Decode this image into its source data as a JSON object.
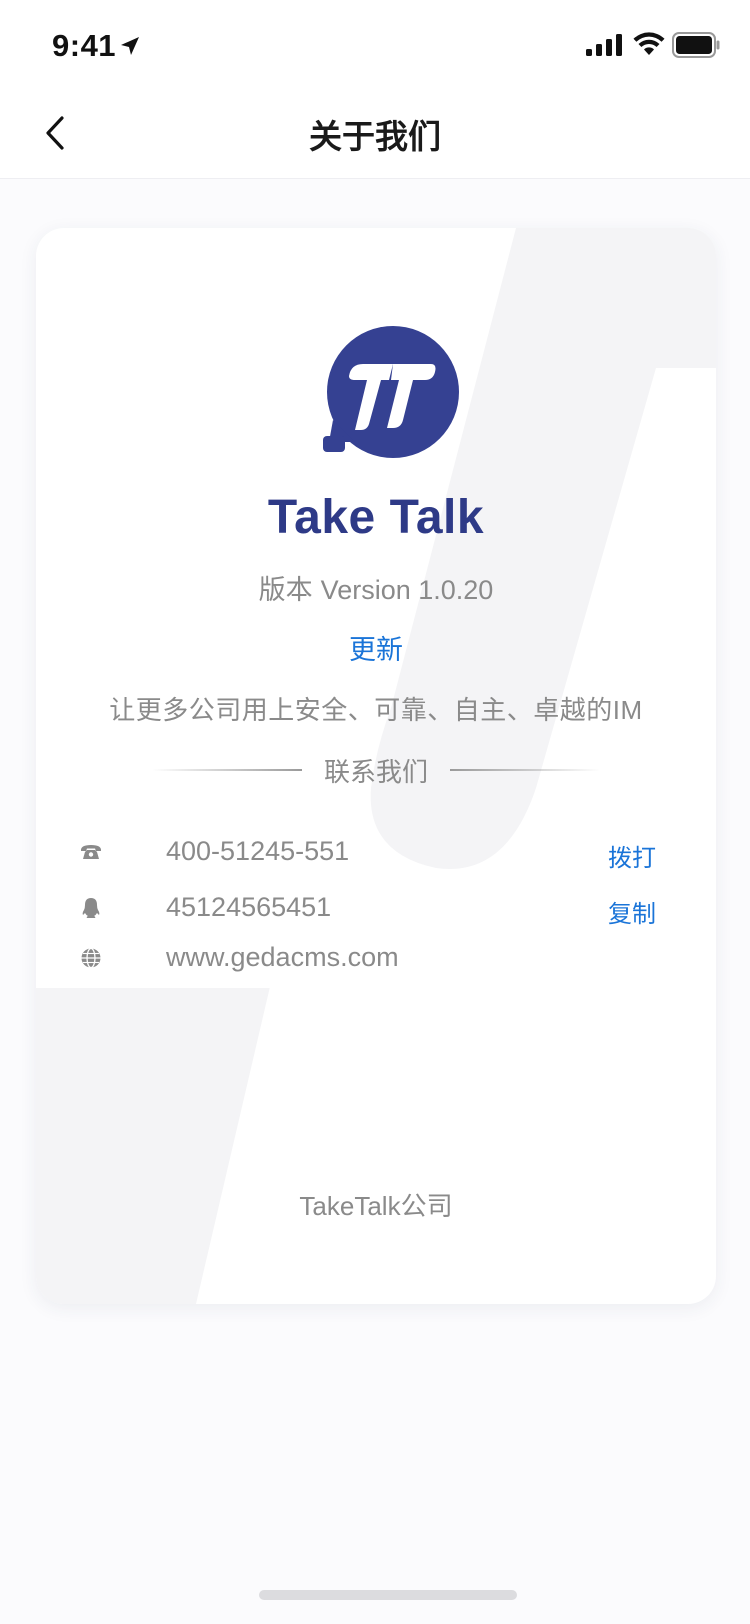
{
  "status_bar": {
    "time": "9:41",
    "icons": [
      "location-arrow-icon",
      "signal-icon",
      "wifi-icon",
      "battery-icon"
    ]
  },
  "nav": {
    "title": "关于我们",
    "back_icon": "chevron-left-icon"
  },
  "about": {
    "app_name": "Take Talk",
    "version_prefix": "版本",
    "version": "Version 1.0.20",
    "update_label": "更新",
    "slogan": "让更多公司用上安全、可靠、自主、卓越的IM"
  },
  "contact": {
    "heading": "联系我们",
    "items": [
      {
        "icon": "phone-icon",
        "text": "400-51245-551",
        "action": "拨打"
      },
      {
        "icon": "qq-icon",
        "text": "45124565451",
        "action": "复制"
      },
      {
        "icon": "globe-icon",
        "text": "www.gedacms.com"
      }
    ]
  },
  "footer": {
    "company": "TakeTalk公司"
  },
  "colors": {
    "brand": "#2e3a87",
    "link": "#1a74d8",
    "muted_text": "#8a8a8a",
    "background": "#fbfbfd"
  }
}
